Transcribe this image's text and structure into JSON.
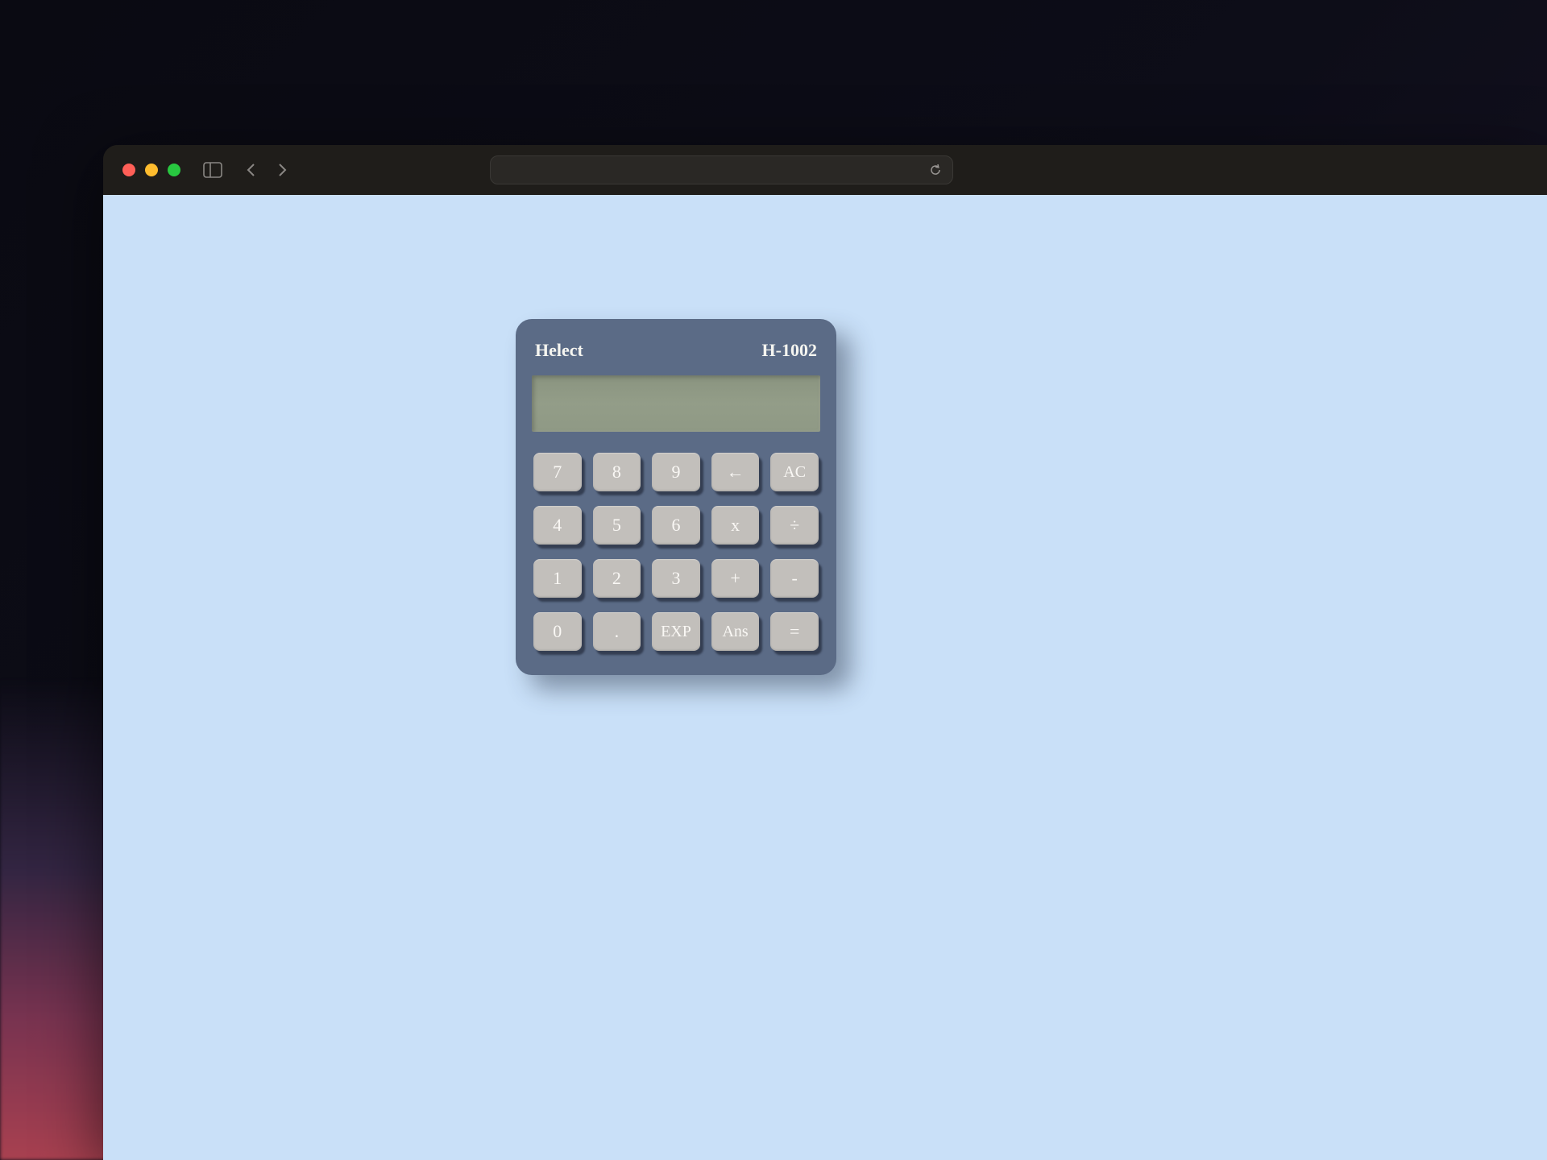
{
  "browser": {
    "traffic": {
      "close": "close",
      "minimize": "minimize",
      "maximize": "maximize"
    },
    "address": ""
  },
  "calculator": {
    "brand": "Helect",
    "model": "H-1002",
    "display": "",
    "keys": [
      {
        "id": "7",
        "label": "7"
      },
      {
        "id": "8",
        "label": "8"
      },
      {
        "id": "9",
        "label": "9"
      },
      {
        "id": "backspace",
        "label": "←"
      },
      {
        "id": "ac",
        "label": "AC"
      },
      {
        "id": "4",
        "label": "4"
      },
      {
        "id": "5",
        "label": "5"
      },
      {
        "id": "6",
        "label": "6"
      },
      {
        "id": "multiply",
        "label": "x"
      },
      {
        "id": "divide",
        "label": "÷"
      },
      {
        "id": "1",
        "label": "1"
      },
      {
        "id": "2",
        "label": "2"
      },
      {
        "id": "3",
        "label": "3"
      },
      {
        "id": "plus",
        "label": "+"
      },
      {
        "id": "minus",
        "label": "-"
      },
      {
        "id": "0",
        "label": "0"
      },
      {
        "id": "decimal",
        "label": "."
      },
      {
        "id": "exp",
        "label": "EXP"
      },
      {
        "id": "ans",
        "label": "Ans"
      },
      {
        "id": "equals",
        "label": "="
      }
    ]
  },
  "colors": {
    "page_bg": "#c9e0f8",
    "calc_body": "#5b6b86",
    "calc_display": "#939d88",
    "key_bg": "#c2bfbb"
  }
}
